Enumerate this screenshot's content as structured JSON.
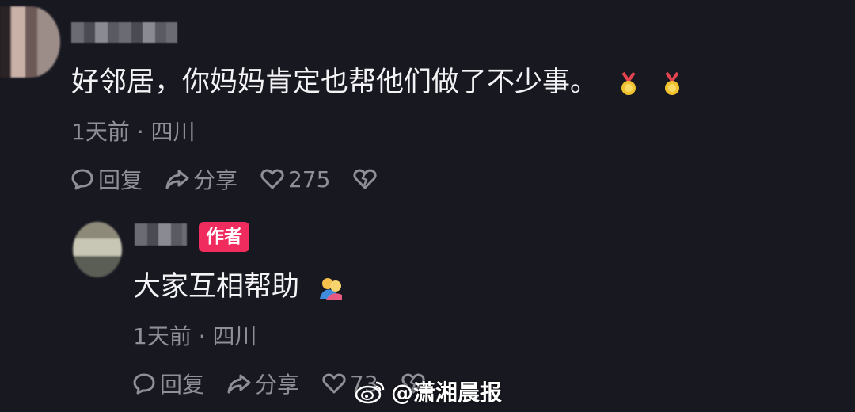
{
  "comment": {
    "text": "好邻居，你妈妈肯定也帮他们做了不少事。",
    "emoji_icons": [
      "medal-icon",
      "medal-icon"
    ],
    "time": "1天前",
    "separator": "·",
    "location": "四川",
    "reply_label": "回复",
    "share_label": "分享",
    "like_count": "275"
  },
  "reply": {
    "author_badge": "作者",
    "text": "大家互相帮助",
    "emoji_icons": [
      "hug-icon"
    ],
    "time": "1天前",
    "separator": "·",
    "location": "四川",
    "reply_label": "回复",
    "share_label": "分享",
    "like_count": "73"
  },
  "watermark": {
    "text": "@潇湘晨报"
  },
  "colors": {
    "background": "#181821",
    "text": "#f3f3f5",
    "muted": "#8f8f98",
    "badge": "#f02b5e"
  }
}
